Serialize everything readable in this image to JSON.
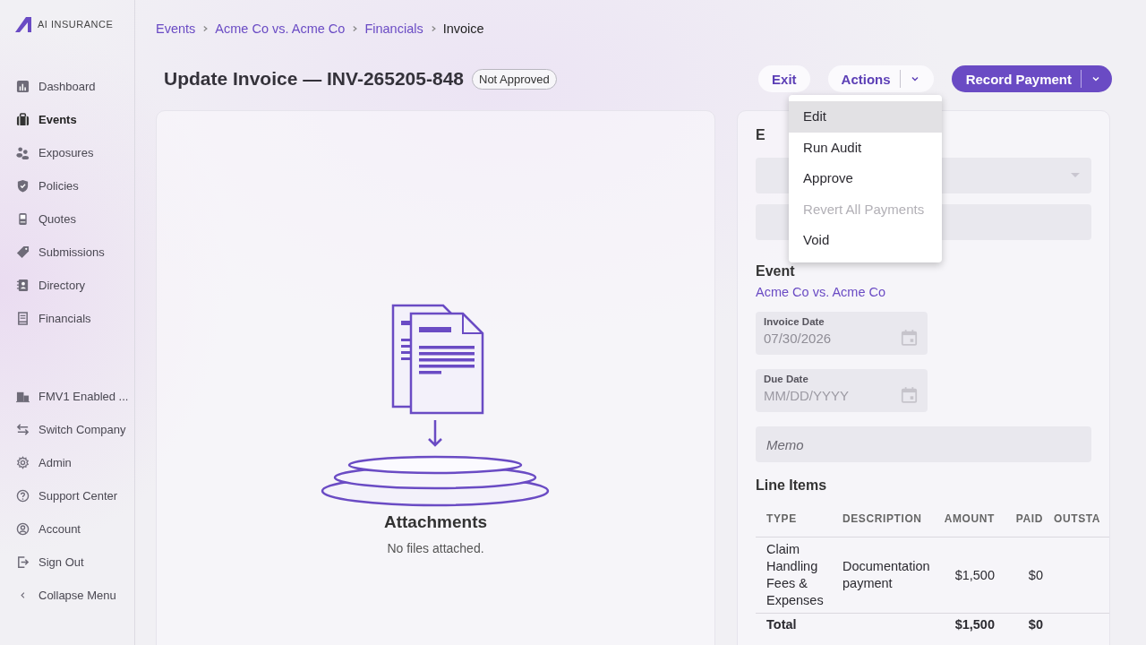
{
  "brand": {
    "name": "AI INSURANCE"
  },
  "sidebar": {
    "items": [
      {
        "label": "Dashboard",
        "kind": "chart",
        "selected": false
      },
      {
        "label": "Events",
        "kind": "briefcase",
        "selected": true
      },
      {
        "label": "Exposures",
        "kind": "people",
        "selected": false
      },
      {
        "label": "Policies",
        "kind": "shield",
        "selected": false
      },
      {
        "label": "Quotes",
        "kind": "phone",
        "selected": false
      },
      {
        "label": "Submissions",
        "kind": "tag",
        "selected": false
      },
      {
        "label": "Directory",
        "kind": "contacts",
        "selected": false
      },
      {
        "label": "Financials",
        "kind": "receipt",
        "selected": false
      }
    ],
    "footer": [
      {
        "label": "FMV1 Enabled ...",
        "kind": "building"
      },
      {
        "label": "Switch Company",
        "kind": "swap"
      },
      {
        "label": "Admin",
        "kind": "gear"
      },
      {
        "label": "Support Center",
        "kind": "help"
      },
      {
        "label": "Account",
        "kind": "user"
      },
      {
        "label": "Sign Out",
        "kind": "signout"
      },
      {
        "label": "Collapse Menu",
        "kind": "chevron"
      }
    ]
  },
  "breadcrumb": [
    {
      "label": "Events",
      "current": false
    },
    {
      "label": "Acme Co vs. Acme Co",
      "current": false
    },
    {
      "label": "Financials",
      "current": false
    },
    {
      "label": "Invoice",
      "current": true
    }
  ],
  "title": "Update Invoice — INV-265205-848",
  "status_badge": "Not Approved",
  "buttons": {
    "exit": "Exit",
    "actions": "Actions",
    "record_payment": "Record Payment"
  },
  "actions_menu": [
    {
      "label": "Edit",
      "selected": true,
      "disabled": false
    },
    {
      "label": "Run Audit",
      "selected": false,
      "disabled": false
    },
    {
      "label": "Approve",
      "selected": false,
      "disabled": false
    },
    {
      "label": "Revert All Payments",
      "selected": false,
      "disabled": true
    },
    {
      "label": "Void",
      "selected": false,
      "disabled": false
    }
  ],
  "attachments": {
    "title": "Attachments",
    "empty_text": "No files attached."
  },
  "form": {
    "section_heading": "E",
    "event": {
      "heading": "Event",
      "link": "Acme Co vs. Acme Co"
    },
    "invoice_date": {
      "label": "Invoice Date",
      "value": "07/30/2026"
    },
    "due_date": {
      "label": "Due Date",
      "placeholder": "MM/DD/YYYY"
    },
    "memo": {
      "placeholder": "Memo"
    }
  },
  "line_items": {
    "title": "Line Items",
    "columns": [
      "TYPE",
      "DESCRIPTION",
      "AMOUNT",
      "PAID",
      "OUTSTA"
    ],
    "rows": [
      {
        "type": "Claim Handling Fees & Expenses",
        "description": "Documentation payment",
        "amount": "$1,500",
        "paid": "$0"
      }
    ],
    "total": {
      "label": "Total",
      "amount": "$1,500",
      "paid": "$0"
    }
  }
}
